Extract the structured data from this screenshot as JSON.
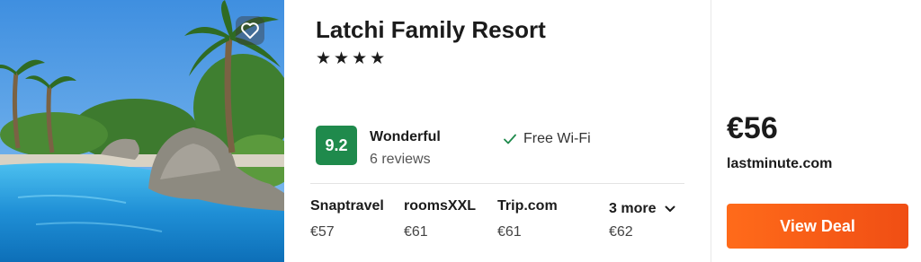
{
  "hotel": {
    "name": "Latchi Family Resort",
    "stars": "★★★★",
    "rating": {
      "score": "9.2",
      "label": "Wonderful",
      "reviews": "6 reviews"
    },
    "amenity": "Free Wi-Fi",
    "icons": {
      "favorite": "heart-icon",
      "amenity": "checkmark-icon",
      "more": "chevron-down-icon"
    }
  },
  "providers": [
    {
      "name": "Snaptravel",
      "price": "€57"
    },
    {
      "name": "roomsXXL",
      "price": "€61"
    },
    {
      "name": "Trip.com",
      "price": "€61"
    }
  ],
  "more_providers": {
    "label": "3 more",
    "price": "€62"
  },
  "best_deal": {
    "price": "€56",
    "provider": "lastminute.com",
    "button_label": "View Deal"
  },
  "colors": {
    "rating_badge": "#1f8a4c",
    "deal_button": "#f25a17",
    "check": "#1f8a4c"
  }
}
